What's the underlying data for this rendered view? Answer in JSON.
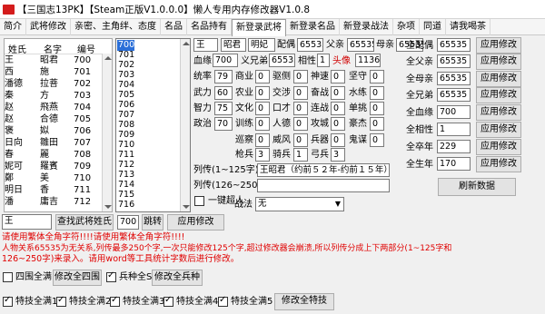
{
  "window": {
    "title": "【三国志13PK】【Steam正版V1.0.0.0】懒人专用内存修改器V1.0.8"
  },
  "tabs": [
    "简介",
    "武将修改",
    "亲密、主角绊、态度",
    "名品",
    "名品持有",
    "新登录武将",
    "新登录名品",
    "新登录战法",
    "杂项",
    "同道",
    "请我喝茶"
  ],
  "active_tab": "新登录武将",
  "officer_list": {
    "headers": {
      "surname": "姓氏",
      "given": "名字",
      "id": "编号"
    },
    "rows": [
      {
        "surname": "王",
        "given": "昭君",
        "id": "700"
      },
      {
        "surname": "西",
        "given": "施",
        "id": "701"
      },
      {
        "surname": "潘德",
        "given": "拉菩",
        "id": "702"
      },
      {
        "surname": "秦",
        "given": "方",
        "id": "703"
      },
      {
        "surname": "赵",
        "given": "飛燕",
        "id": "704"
      },
      {
        "surname": "赵",
        "given": "合德",
        "id": "705"
      },
      {
        "surname": "褒",
        "given": "姒",
        "id": "706"
      },
      {
        "surname": "日向",
        "given": "雛田",
        "id": "707"
      },
      {
        "surname": "春",
        "given": "麗",
        "id": "708"
      },
      {
        "surname": "妮可",
        "given": "羅賓",
        "id": "709"
      },
      {
        "surname": "鄭",
        "given": "美",
        "id": "710"
      },
      {
        "surname": "明日",
        "given": "香",
        "id": "711"
      },
      {
        "surname": "潘",
        "given": "庸吉",
        "id": "712"
      }
    ]
  },
  "id_listbox": {
    "items": [
      "700",
      "701",
      "702",
      "703",
      "704",
      "705",
      "706",
      "707",
      "708",
      "709",
      "710",
      "711",
      "712",
      "713",
      "714",
      "715",
      "716"
    ],
    "selected": "700"
  },
  "officer": {
    "surname": "王",
    "given": "昭君",
    "style": "明妃",
    "spouse_label": "配偶",
    "spouse": "65535",
    "father_label": "父亲",
    "father": "65535",
    "mother_label": "母亲",
    "mother": "65535",
    "blood_label": "血缘",
    "blood": "700",
    "sworn_father_label": "义兄弟",
    "sworn_father": "65535",
    "affinity_label": "相性",
    "affinity": "1",
    "status": "头像",
    "face": "1136",
    "stats": [
      {
        "label": "统率",
        "value": "79"
      },
      {
        "label": "武力",
        "value": "60"
      },
      {
        "label": "智力",
        "value": "75"
      },
      {
        "label": "政治",
        "value": "70"
      }
    ],
    "skills_col1": [
      {
        "label": "商业",
        "value": "0"
      },
      {
        "label": "农业",
        "value": "0"
      },
      {
        "label": "文化",
        "value": "0"
      },
      {
        "label": "训练",
        "value": "0"
      },
      {
        "label": "巡察",
        "value": "0"
      },
      {
        "label": "枪兵",
        "value": "3"
      }
    ],
    "skills_col2": [
      {
        "label": "驱侧",
        "value": "0"
      },
      {
        "label": "交涉",
        "value": "0"
      },
      {
        "label": "口才",
        "value": "0"
      },
      {
        "label": "人德",
        "value": "0"
      },
      {
        "label": "威风",
        "value": "0"
      },
      {
        "label": "骑兵",
        "value": "1"
      }
    ],
    "skills_col3": [
      {
        "label": "神速",
        "value": "0"
      },
      {
        "label": "奋战",
        "value": "0"
      },
      {
        "label": "连战",
        "value": "0"
      },
      {
        "label": "攻城",
        "value": "0"
      },
      {
        "label": "兵器",
        "value": "0"
      },
      {
        "label": "弓兵",
        "value": "3"
      }
    ],
    "skills_col4": [
      {
        "label": "坚守",
        "value": "0"
      },
      {
        "label": "水练",
        "value": "0"
      },
      {
        "label": "单挑",
        "value": "0"
      },
      {
        "label": "豪杰",
        "value": "0"
      },
      {
        "label": "鬼谋",
        "value": "0"
      }
    ],
    "bio1_label": "列传(1~125字)",
    "bio1": "王昭君（约前５２年-约前１５年），名嫱",
    "bio2_label": "列传(126~250字)",
    "bio2": "",
    "one_key_label": "一键超人",
    "tactic_label": "战法",
    "tactic": "无"
  },
  "right_panel": {
    "rows": [
      {
        "label": "全配偶",
        "value": "65535",
        "button": "应用修改"
      },
      {
        "label": "全父亲",
        "value": "65535",
        "button": "应用修改"
      },
      {
        "label": "全母亲",
        "value": "65535",
        "button": "应用修改"
      },
      {
        "label": "全兄弟",
        "value": "65535",
        "button": "应用修改"
      },
      {
        "label": "全血缘",
        "value": "700",
        "button": "应用修改"
      },
      {
        "label": "全相性",
        "value": "1",
        "button": "应用修改"
      },
      {
        "label": "全卒年",
        "value": "229",
        "button": "应用修改"
      },
      {
        "label": "全生年",
        "value": "170",
        "button": "应用修改"
      }
    ],
    "refresh_button": "刷新数据"
  },
  "search": {
    "input_value": "王",
    "search_button": "查找武将姓氏",
    "jump_value": "700",
    "jump_button": "跳转",
    "apply_button": "应用修改"
  },
  "warnings": [
    "请使用繁体全角字符!!!!请使用繁体全角字符!!!!",
    "人物关系65535为无关系,列传最多250个字,一次只能修改125个字,超过修改器会崩溃,所以列传分成上下两部分(1~125字和",
    "126~250字)来录入。请用word等工具统计字数后进行修改。"
  ],
  "bottom": {
    "four_round_label": "四围全满",
    "four_round_button": "修改全四围",
    "troops_label": "兵种全S",
    "troops_button": "修改全兵种",
    "specials": [
      "特技全满1",
      "特技全满2",
      "特技全满3",
      "特技全满4",
      "特技全满5"
    ],
    "specials_button": "修改全特技"
  }
}
